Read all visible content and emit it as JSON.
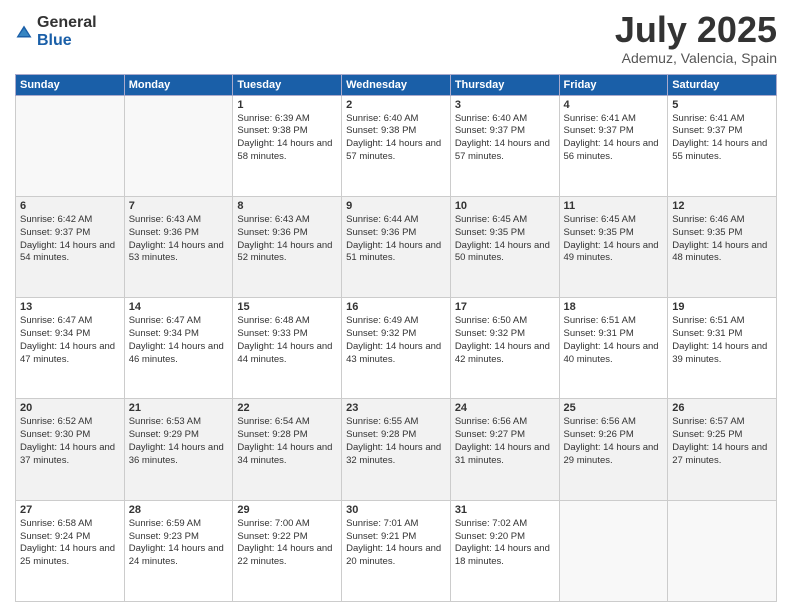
{
  "logo": {
    "general": "General",
    "blue": "Blue"
  },
  "title": "July 2025",
  "location": "Ademuz, Valencia, Spain",
  "days_of_week": [
    "Sunday",
    "Monday",
    "Tuesday",
    "Wednesday",
    "Thursday",
    "Friday",
    "Saturday"
  ],
  "weeks": [
    {
      "alt": false,
      "days": [
        {
          "num": "",
          "empty": true,
          "sunrise": "",
          "sunset": "",
          "daylight": ""
        },
        {
          "num": "",
          "empty": true,
          "sunrise": "",
          "sunset": "",
          "daylight": ""
        },
        {
          "num": "1",
          "empty": false,
          "sunrise": "Sunrise: 6:39 AM",
          "sunset": "Sunset: 9:38 PM",
          "daylight": "Daylight: 14 hours and 58 minutes."
        },
        {
          "num": "2",
          "empty": false,
          "sunrise": "Sunrise: 6:40 AM",
          "sunset": "Sunset: 9:38 PM",
          "daylight": "Daylight: 14 hours and 57 minutes."
        },
        {
          "num": "3",
          "empty": false,
          "sunrise": "Sunrise: 6:40 AM",
          "sunset": "Sunset: 9:37 PM",
          "daylight": "Daylight: 14 hours and 57 minutes."
        },
        {
          "num": "4",
          "empty": false,
          "sunrise": "Sunrise: 6:41 AM",
          "sunset": "Sunset: 9:37 PM",
          "daylight": "Daylight: 14 hours and 56 minutes."
        },
        {
          "num": "5",
          "empty": false,
          "sunrise": "Sunrise: 6:41 AM",
          "sunset": "Sunset: 9:37 PM",
          "daylight": "Daylight: 14 hours and 55 minutes."
        }
      ]
    },
    {
      "alt": true,
      "days": [
        {
          "num": "6",
          "empty": false,
          "sunrise": "Sunrise: 6:42 AM",
          "sunset": "Sunset: 9:37 PM",
          "daylight": "Daylight: 14 hours and 54 minutes."
        },
        {
          "num": "7",
          "empty": false,
          "sunrise": "Sunrise: 6:43 AM",
          "sunset": "Sunset: 9:36 PM",
          "daylight": "Daylight: 14 hours and 53 minutes."
        },
        {
          "num": "8",
          "empty": false,
          "sunrise": "Sunrise: 6:43 AM",
          "sunset": "Sunset: 9:36 PM",
          "daylight": "Daylight: 14 hours and 52 minutes."
        },
        {
          "num": "9",
          "empty": false,
          "sunrise": "Sunrise: 6:44 AM",
          "sunset": "Sunset: 9:36 PM",
          "daylight": "Daylight: 14 hours and 51 minutes."
        },
        {
          "num": "10",
          "empty": false,
          "sunrise": "Sunrise: 6:45 AM",
          "sunset": "Sunset: 9:35 PM",
          "daylight": "Daylight: 14 hours and 50 minutes."
        },
        {
          "num": "11",
          "empty": false,
          "sunrise": "Sunrise: 6:45 AM",
          "sunset": "Sunset: 9:35 PM",
          "daylight": "Daylight: 14 hours and 49 minutes."
        },
        {
          "num": "12",
          "empty": false,
          "sunrise": "Sunrise: 6:46 AM",
          "sunset": "Sunset: 9:35 PM",
          "daylight": "Daylight: 14 hours and 48 minutes."
        }
      ]
    },
    {
      "alt": false,
      "days": [
        {
          "num": "13",
          "empty": false,
          "sunrise": "Sunrise: 6:47 AM",
          "sunset": "Sunset: 9:34 PM",
          "daylight": "Daylight: 14 hours and 47 minutes."
        },
        {
          "num": "14",
          "empty": false,
          "sunrise": "Sunrise: 6:47 AM",
          "sunset": "Sunset: 9:34 PM",
          "daylight": "Daylight: 14 hours and 46 minutes."
        },
        {
          "num": "15",
          "empty": false,
          "sunrise": "Sunrise: 6:48 AM",
          "sunset": "Sunset: 9:33 PM",
          "daylight": "Daylight: 14 hours and 44 minutes."
        },
        {
          "num": "16",
          "empty": false,
          "sunrise": "Sunrise: 6:49 AM",
          "sunset": "Sunset: 9:32 PM",
          "daylight": "Daylight: 14 hours and 43 minutes."
        },
        {
          "num": "17",
          "empty": false,
          "sunrise": "Sunrise: 6:50 AM",
          "sunset": "Sunset: 9:32 PM",
          "daylight": "Daylight: 14 hours and 42 minutes."
        },
        {
          "num": "18",
          "empty": false,
          "sunrise": "Sunrise: 6:51 AM",
          "sunset": "Sunset: 9:31 PM",
          "daylight": "Daylight: 14 hours and 40 minutes."
        },
        {
          "num": "19",
          "empty": false,
          "sunrise": "Sunrise: 6:51 AM",
          "sunset": "Sunset: 9:31 PM",
          "daylight": "Daylight: 14 hours and 39 minutes."
        }
      ]
    },
    {
      "alt": true,
      "days": [
        {
          "num": "20",
          "empty": false,
          "sunrise": "Sunrise: 6:52 AM",
          "sunset": "Sunset: 9:30 PM",
          "daylight": "Daylight: 14 hours and 37 minutes."
        },
        {
          "num": "21",
          "empty": false,
          "sunrise": "Sunrise: 6:53 AM",
          "sunset": "Sunset: 9:29 PM",
          "daylight": "Daylight: 14 hours and 36 minutes."
        },
        {
          "num": "22",
          "empty": false,
          "sunrise": "Sunrise: 6:54 AM",
          "sunset": "Sunset: 9:28 PM",
          "daylight": "Daylight: 14 hours and 34 minutes."
        },
        {
          "num": "23",
          "empty": false,
          "sunrise": "Sunrise: 6:55 AM",
          "sunset": "Sunset: 9:28 PM",
          "daylight": "Daylight: 14 hours and 32 minutes."
        },
        {
          "num": "24",
          "empty": false,
          "sunrise": "Sunrise: 6:56 AM",
          "sunset": "Sunset: 9:27 PM",
          "daylight": "Daylight: 14 hours and 31 minutes."
        },
        {
          "num": "25",
          "empty": false,
          "sunrise": "Sunrise: 6:56 AM",
          "sunset": "Sunset: 9:26 PM",
          "daylight": "Daylight: 14 hours and 29 minutes."
        },
        {
          "num": "26",
          "empty": false,
          "sunrise": "Sunrise: 6:57 AM",
          "sunset": "Sunset: 9:25 PM",
          "daylight": "Daylight: 14 hours and 27 minutes."
        }
      ]
    },
    {
      "alt": false,
      "days": [
        {
          "num": "27",
          "empty": false,
          "sunrise": "Sunrise: 6:58 AM",
          "sunset": "Sunset: 9:24 PM",
          "daylight": "Daylight: 14 hours and 25 minutes."
        },
        {
          "num": "28",
          "empty": false,
          "sunrise": "Sunrise: 6:59 AM",
          "sunset": "Sunset: 9:23 PM",
          "daylight": "Daylight: 14 hours and 24 minutes."
        },
        {
          "num": "29",
          "empty": false,
          "sunrise": "Sunrise: 7:00 AM",
          "sunset": "Sunset: 9:22 PM",
          "daylight": "Daylight: 14 hours and 22 minutes."
        },
        {
          "num": "30",
          "empty": false,
          "sunrise": "Sunrise: 7:01 AM",
          "sunset": "Sunset: 9:21 PM",
          "daylight": "Daylight: 14 hours and 20 minutes."
        },
        {
          "num": "31",
          "empty": false,
          "sunrise": "Sunrise: 7:02 AM",
          "sunset": "Sunset: 9:20 PM",
          "daylight": "Daylight: 14 hours and 18 minutes."
        },
        {
          "num": "",
          "empty": true,
          "sunrise": "",
          "sunset": "",
          "daylight": ""
        },
        {
          "num": "",
          "empty": true,
          "sunrise": "",
          "sunset": "",
          "daylight": ""
        }
      ]
    }
  ]
}
